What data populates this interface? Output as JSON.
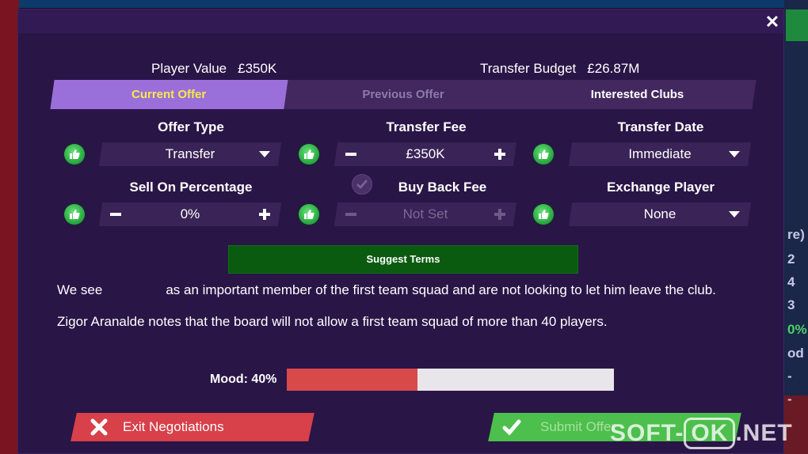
{
  "stats": {
    "player_value_label": "Player Value",
    "player_value": "£350K",
    "transfer_budget_label": "Transfer Budget",
    "transfer_budget": "£26.87M"
  },
  "tabs": [
    {
      "label": "Current Offer",
      "state": "active"
    },
    {
      "label": "Previous Offer",
      "state": "disabled"
    },
    {
      "label": "Interested Clubs",
      "state": "normal"
    }
  ],
  "fields": {
    "offer_type": {
      "label": "Offer Type",
      "value": "Transfer"
    },
    "transfer_fee": {
      "label": "Transfer Fee",
      "value": "£350K"
    },
    "transfer_date": {
      "label": "Transfer Date",
      "value": "Immediate"
    },
    "sell_on": {
      "label": "Sell On Percentage",
      "value": "0%"
    },
    "buy_back": {
      "label": "Buy Back Fee",
      "value": "Not Set",
      "enabled": false
    },
    "exchange_player": {
      "label": "Exchange Player",
      "value": "None"
    }
  },
  "suggest_button": "Suggest Terms",
  "messages": {
    "line1_a": "We see",
    "line1_b": "as an important member of the first team squad and are not looking to let him leave the club.",
    "line2": "Zigor Aranalde notes that the board will not allow a first team squad of more than 40 players."
  },
  "mood": {
    "label": "Mood: 40%",
    "fraction": 0.4
  },
  "buttons": {
    "exit": "Exit Negotiations",
    "submit": "Submit Offer"
  },
  "background_fragments": [
    "re)",
    "2",
    "4",
    "3",
    "0%",
    "od",
    "-",
    "-"
  ],
  "watermark": {
    "left": "SOFT-",
    "mid": "OK",
    "right": ".NET"
  },
  "colors": {
    "accent_purple": "#9b6fd9",
    "active_tab_text": "#f5e94a",
    "suggest_green": "#0a5a0f",
    "mood_red": "#d8494a",
    "exit_red": "#d8404a",
    "submit_green": "#4cbf4c"
  }
}
